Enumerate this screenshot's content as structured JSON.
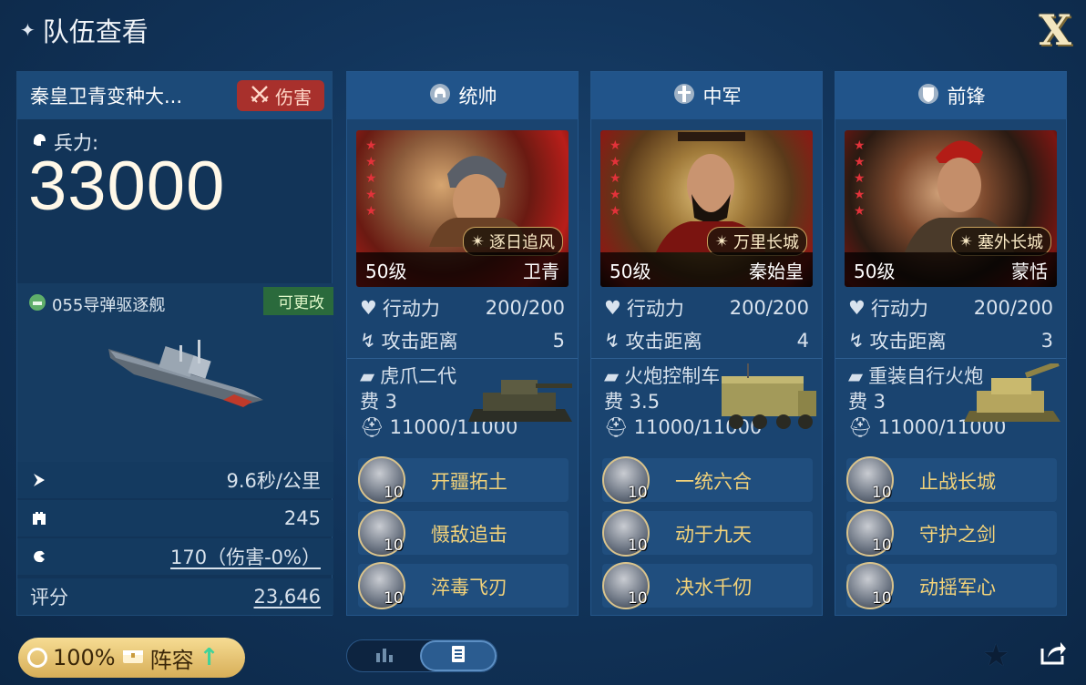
{
  "header": {
    "title": "队伍查看",
    "close_label": "X"
  },
  "team": {
    "name": "秦皇卫青变种大...",
    "type_badge": "伤害",
    "troops_label": "兵力:",
    "troops_value": "33000",
    "ship": {
      "name": "055导弹驱逐舰",
      "edit_label": "可更改"
    },
    "stats": [
      {
        "icon": "speed-icon",
        "value": "9.6秒/公里"
      },
      {
        "icon": "siege-icon",
        "value": "245"
      },
      {
        "icon": "attack-icon",
        "value": "170（伤害-0%）"
      }
    ],
    "score_label": "评分",
    "score_value": "23,646"
  },
  "columns": [
    {
      "role": "统帅",
      "level": "50级",
      "hero": "卫青",
      "tactic": "逐日追风",
      "stars": 5,
      "action_label": "行动力",
      "action_value": "200/200",
      "range_label": "攻击距离",
      "range_value": "5",
      "unit_name": "虎爪二代",
      "cost": "费 3",
      "hp": "11000/11000",
      "skills": [
        {
          "name": "开疆拓土",
          "level": "10"
        },
        {
          "name": "慑敌追击",
          "level": "10"
        },
        {
          "name": "淬毒飞刃",
          "level": "10"
        }
      ]
    },
    {
      "role": "中军",
      "level": "50级",
      "hero": "秦始皇",
      "tactic": "万里长城",
      "stars": 5,
      "action_label": "行动力",
      "action_value": "200/200",
      "range_label": "攻击距离",
      "range_value": "4",
      "unit_name": "火炮控制车",
      "cost": "费 3.5",
      "hp": "11000/11000",
      "skills": [
        {
          "name": "一统六合",
          "level": "10"
        },
        {
          "name": "动于九天",
          "level": "10"
        },
        {
          "name": "决水千仞",
          "level": "10"
        }
      ]
    },
    {
      "role": "前锋",
      "level": "50级",
      "hero": "蒙恬",
      "tactic": "塞外长城",
      "stars": 5,
      "action_label": "行动力",
      "action_value": "200/200",
      "range_label": "攻击距离",
      "range_value": "3",
      "unit_name": "重装自行火炮",
      "cost": "费 3",
      "hp": "11000/11000",
      "skills": [
        {
          "name": "止战长城",
          "level": "10"
        },
        {
          "name": "守护之剑",
          "level": "10"
        },
        {
          "name": "动摇军心",
          "level": "10"
        }
      ]
    }
  ],
  "footer": {
    "rate": "100%",
    "lineup_label": "阵容"
  },
  "colors": {
    "bg": "#12355c",
    "gold": "#f2d27a",
    "damage": "#a8302c"
  }
}
